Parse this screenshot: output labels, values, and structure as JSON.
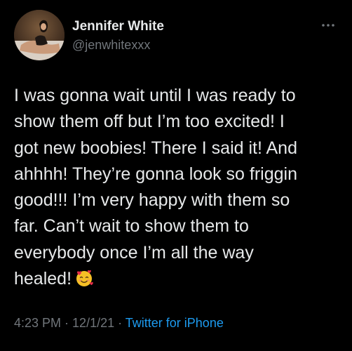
{
  "user": {
    "display_name": "Jennifer White",
    "handle": "@jenwhitexxx"
  },
  "tweet": {
    "lines": [
      "I was gonna wait until I was ready to",
      "show them off but I’m too excited! I",
      "got new boobies! There I said it! And",
      "ahhhh! They’re gonna look so friggin",
      "good!!! I’m very happy with them so",
      "far. Can’t wait to show them to",
      "everybody once I’m all the way",
      "healed!"
    ],
    "emoji": "smiling-face-with-hearts-icon"
  },
  "meta": {
    "time": "4:23 PM",
    "separator_1": " · ",
    "date": "12/1/21",
    "separator_2": " · ",
    "source": "Twitter for iPhone"
  },
  "colors": {
    "background": "#000000",
    "primary_text": "#e7e9ea",
    "secondary_text": "#71767b",
    "link": "#1d9bf0"
  },
  "icons": {
    "more": "more-options-icon"
  }
}
